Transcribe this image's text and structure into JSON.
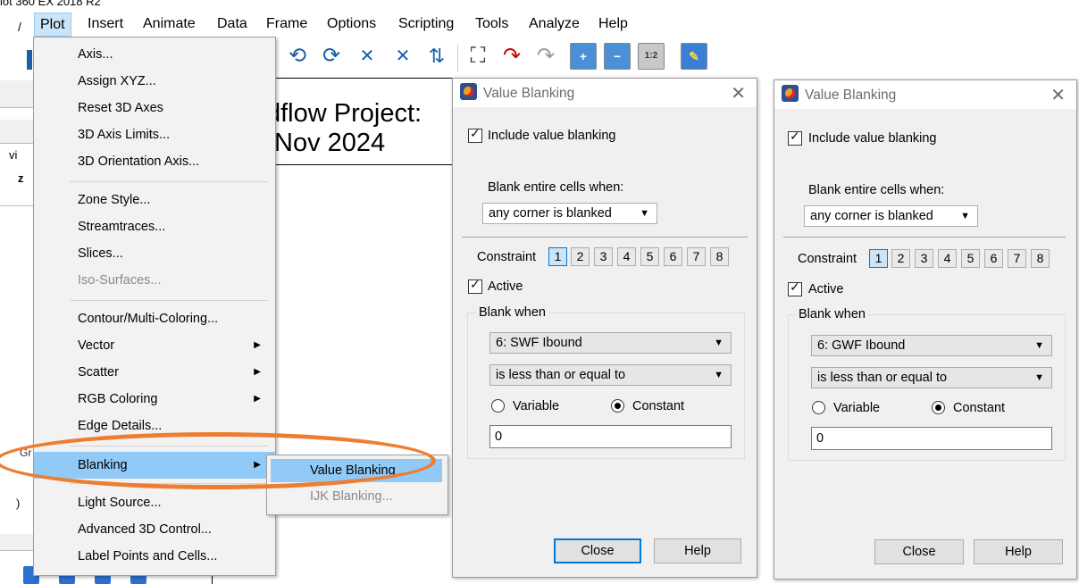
{
  "app": {
    "title_fragment": "lot 360 EX 2018 R2"
  },
  "menubar": {
    "items": [
      {
        "label": "Plot"
      },
      {
        "label": "Insert"
      },
      {
        "label": "Animate"
      },
      {
        "label": "Data"
      },
      {
        "label": "Frame"
      },
      {
        "label": "Options"
      },
      {
        "label": "Scripting"
      },
      {
        "label": "Tools"
      },
      {
        "label": "Analyze"
      },
      {
        "label": "Help"
      }
    ]
  },
  "plot": {
    "title_line1": "dflow Project:",
    "title_line2": "Nov 2024"
  },
  "left_frags": {
    "a": "vi",
    "b": "z",
    "c": "Gr",
    "d": ")"
  },
  "plot_menu": {
    "items": [
      {
        "label": "Axis...",
        "enabled": true
      },
      {
        "label": "Assign XYZ...",
        "enabled": true
      },
      {
        "label": "Reset 3D Axes",
        "enabled": true
      },
      {
        "label": "3D Axis Limits...",
        "enabled": true
      },
      {
        "label": "3D Orientation Axis...",
        "enabled": true
      },
      {
        "label": "Zone Style...",
        "enabled": true
      },
      {
        "label": "Streamtraces...",
        "enabled": true
      },
      {
        "label": "Slices...",
        "enabled": true
      },
      {
        "label": "Iso-Surfaces...",
        "enabled": false
      },
      {
        "label": "Contour/Multi-Coloring...",
        "enabled": true
      },
      {
        "label": "Vector",
        "enabled": true,
        "submenu": true
      },
      {
        "label": "Scatter",
        "enabled": true,
        "submenu": true
      },
      {
        "label": "RGB Coloring",
        "enabled": true,
        "submenu": true
      },
      {
        "label": "Edge Details...",
        "enabled": true
      },
      {
        "label": "Blanking",
        "enabled": true,
        "submenu": true,
        "highlighted": true
      },
      {
        "label": "Light Source...",
        "enabled": true
      },
      {
        "label": "Advanced 3D Control...",
        "enabled": true
      },
      {
        "label": "Label Points and Cells...",
        "enabled": true
      }
    ]
  },
  "blanking_submenu": {
    "items": [
      {
        "label": "Value Blanking",
        "enabled": true,
        "highlighted": true
      },
      {
        "label": "IJK Blanking...",
        "enabled": false
      }
    ]
  },
  "dialogs": [
    {
      "title": "Value Blanking",
      "include_label": "Include value blanking",
      "include_checked": true,
      "blank_cells_label": "Blank entire cells when:",
      "blank_cells_value": "any corner is blanked",
      "constraint_label": "Constraint",
      "constraints": [
        "1",
        "2",
        "3",
        "4",
        "5",
        "6",
        "7",
        "8"
      ],
      "selected_constraint": "1",
      "active_label": "Active",
      "active_checked": true,
      "blank_when_label": "Blank when",
      "variable_value": "6: SWF Ibound",
      "operator_value": "is less than or equal to",
      "radio_variable": "Variable",
      "radio_constant": "Constant",
      "selected_radio": "Constant",
      "constant_value": "0",
      "close_label": "Close",
      "help_label": "Help"
    },
    {
      "title": "Value Blanking",
      "include_label": "Include value blanking",
      "include_checked": true,
      "blank_cells_label": "Blank entire cells when:",
      "blank_cells_value": "any corner is blanked",
      "constraint_label": "Constraint",
      "constraints": [
        "1",
        "2",
        "3",
        "4",
        "5",
        "6",
        "7",
        "8"
      ],
      "selected_constraint": "1",
      "active_label": "Active",
      "active_checked": true,
      "blank_when_label": "Blank when",
      "variable_value": "6: GWF Ibound",
      "operator_value": "is less than or equal to",
      "radio_variable": "Variable",
      "radio_constant": "Constant",
      "selected_radio": "Constant",
      "constant_value": "0",
      "close_label": "Close",
      "help_label": "Help"
    }
  ],
  "colors": {
    "highlight": "#91c9f7",
    "annotation": "#ed7d31",
    "focus": "#0078d7"
  }
}
